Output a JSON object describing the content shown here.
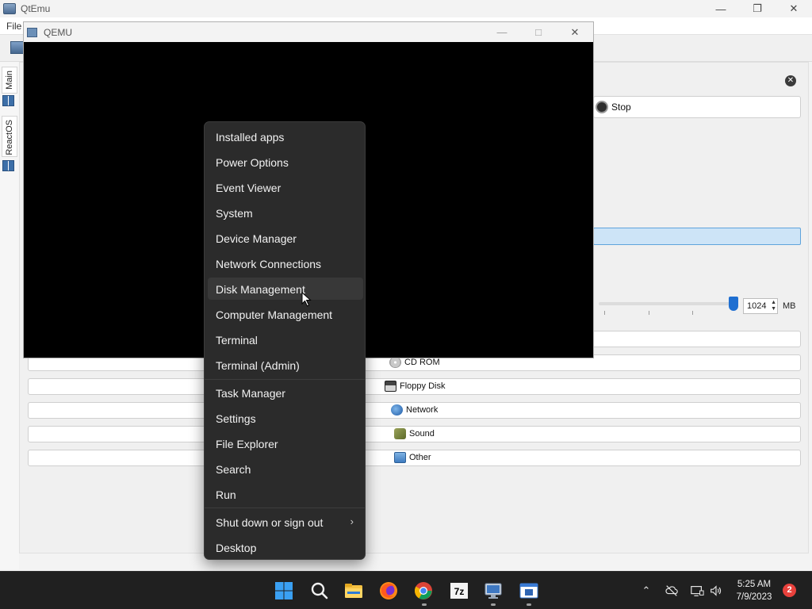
{
  "qtemu": {
    "title": "QtEmu",
    "menu": {
      "file": "File"
    },
    "side_tabs": [
      {
        "label": "Main"
      },
      {
        "label": "ReactOS"
      }
    ],
    "controls": {
      "stop_label": "Stop"
    },
    "memory": {
      "value": "1024",
      "unit": "MB",
      "slider_fraction": 0.99
    },
    "devices": [
      {
        "label": "CD ROM",
        "icon": "cd-rom-icon"
      },
      {
        "label": "Floppy Disk",
        "icon": "floppy-disk-icon"
      },
      {
        "label": "Network",
        "icon": "network-icon"
      },
      {
        "label": "Sound",
        "icon": "sound-icon"
      },
      {
        "label": "Other",
        "icon": "other-device-icon"
      }
    ]
  },
  "qemu": {
    "title": "QEMU"
  },
  "context_menu": {
    "items": [
      {
        "label": "Installed apps"
      },
      {
        "label": "Power Options"
      },
      {
        "label": "Event Viewer"
      },
      {
        "label": "System"
      },
      {
        "label": "Device Manager"
      },
      {
        "label": "Network Connections"
      },
      {
        "label": "Disk Management",
        "hovered": true
      },
      {
        "label": "Computer Management"
      },
      {
        "label": "Terminal"
      },
      {
        "label": "Terminal (Admin)"
      },
      {
        "label": "Task Manager"
      },
      {
        "label": "Settings"
      },
      {
        "label": "File Explorer"
      },
      {
        "label": "Search"
      },
      {
        "label": "Run"
      },
      {
        "label": "Shut down or sign out",
        "has_submenu": true
      },
      {
        "label": "Desktop"
      }
    ]
  },
  "taskbar": {
    "pinned": [
      {
        "icon": "windows-start-icon"
      },
      {
        "icon": "search-icon"
      },
      {
        "icon": "file-explorer-icon"
      },
      {
        "icon": "firefox-icon"
      },
      {
        "icon": "chrome-icon",
        "running": true
      },
      {
        "icon": "7zip-icon"
      },
      {
        "icon": "qemu-app-icon",
        "running": true
      },
      {
        "icon": "qtemu-app-icon",
        "running": true
      }
    ],
    "tray": {
      "time": "5:25 AM",
      "date": "7/9/2023",
      "notifications": "2"
    }
  },
  "colors": {
    "accent": "#1f6fd1",
    "menu_bg": "#2b2b2b",
    "taskbar_bg": "#202020",
    "badge": "#e8413c"
  }
}
